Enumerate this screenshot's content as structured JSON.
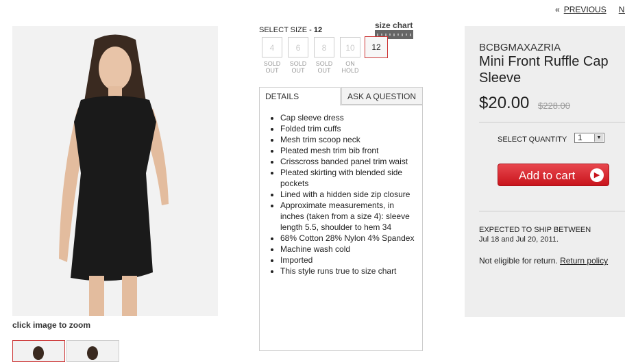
{
  "nav": {
    "prev_label": "PREVIOUS",
    "next_label": "NEXT",
    "arrow": "«"
  },
  "image": {
    "zoom_text": "click image to zoom"
  },
  "size": {
    "label": "SELECT SIZE - ",
    "selected": "12",
    "chart_link": "size chart",
    "options": [
      {
        "label": "4",
        "status": "SOLD OUT"
      },
      {
        "label": "6",
        "status": "SOLD OUT"
      },
      {
        "label": "8",
        "status": "SOLD OUT"
      },
      {
        "label": "10",
        "status": "ON HOLD"
      },
      {
        "label": "12",
        "status": ""
      }
    ]
  },
  "tabs": [
    {
      "label": "DETAILS"
    },
    {
      "label": "ASK A QUESTION"
    }
  ],
  "details": [
    "Cap sleeve dress",
    "Folded trim cuffs",
    "Mesh trim scoop neck",
    "Pleated mesh trim bib front",
    "Crisscross banded panel trim waist",
    "Pleated skirting with blended side pockets",
    "Lined with a hidden side zip closure",
    "Approximate measurements, in inches (taken from a size 4): sleeve length 5.5, shoulder to hem 34",
    "68% Cotton 28% Nylon 4% Spandex",
    "Machine wash cold",
    "Imported",
    "This style runs true to size chart"
  ],
  "product": {
    "brand": "BCBGMAXAZRIA",
    "name": "Mini Front Ruffle Cap Sleeve",
    "price": "$20.00",
    "old_price": "$228.00",
    "qty_label": "SELECT QUANTITY",
    "qty_value": "1",
    "add_to_cart": "Add to cart",
    "ship_label": "EXPECTED TO SHIP BETWEEN",
    "ship_dates": "Jul 18 and Jul 20, 2011.",
    "return_text": "Not eligible for return. ",
    "return_link": "Return policy"
  },
  "colors": {
    "accent_red": "#c8141c",
    "panel_bg": "#eeeeee"
  }
}
